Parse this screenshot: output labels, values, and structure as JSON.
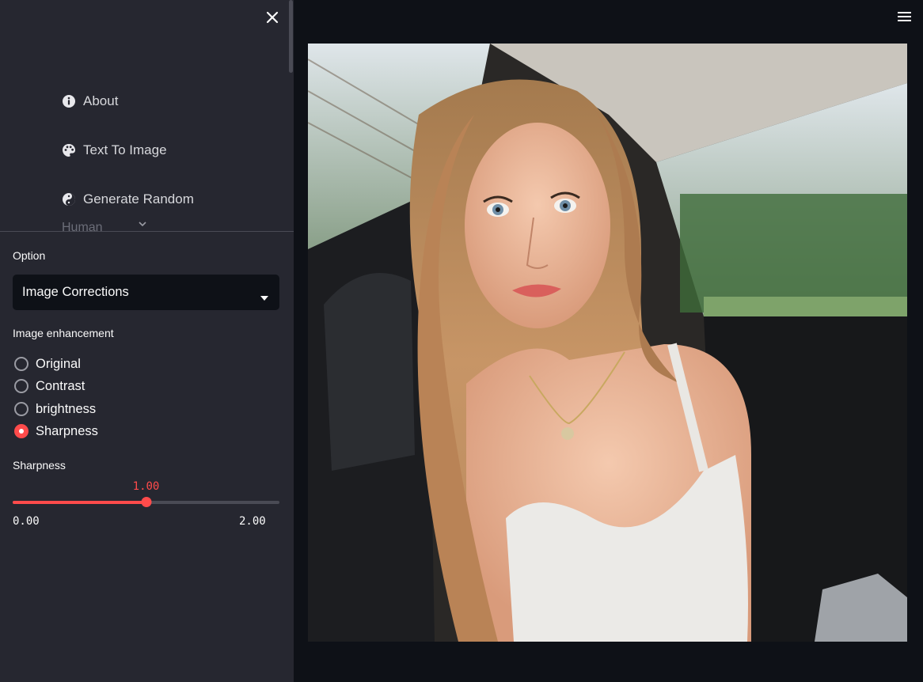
{
  "sidebar": {
    "nav": [
      {
        "label": "About",
        "icon": "info-circle-icon"
      },
      {
        "label": "Text To Image",
        "icon": "palette-icon"
      },
      {
        "label": "Generate Random",
        "icon": "yin-yang-icon"
      },
      {
        "label": "Human",
        "icon": "chevron-down-icon"
      }
    ],
    "option_label": "Option",
    "option_value": "Image Corrections",
    "enhancement_label": "Image enhancement",
    "radios": [
      {
        "label": "Original",
        "selected": false
      },
      {
        "label": "Contrast",
        "selected": false
      },
      {
        "label": "brightness",
        "selected": false
      },
      {
        "label": "Sharpness",
        "selected": true
      }
    ],
    "slider": {
      "label": "Sharpness",
      "value": 1.0,
      "value_text": "1.00",
      "min_text": "0.00",
      "max_text": "2.00",
      "min": 0,
      "max": 2
    }
  },
  "colors": {
    "accent": "#ff4b4b",
    "sidebar_bg": "#262730",
    "main_bg": "#0e1117"
  },
  "main": {
    "image": "photo of a young woman with long blonde hair in a white tank top taking a selfie in a car back seat"
  }
}
